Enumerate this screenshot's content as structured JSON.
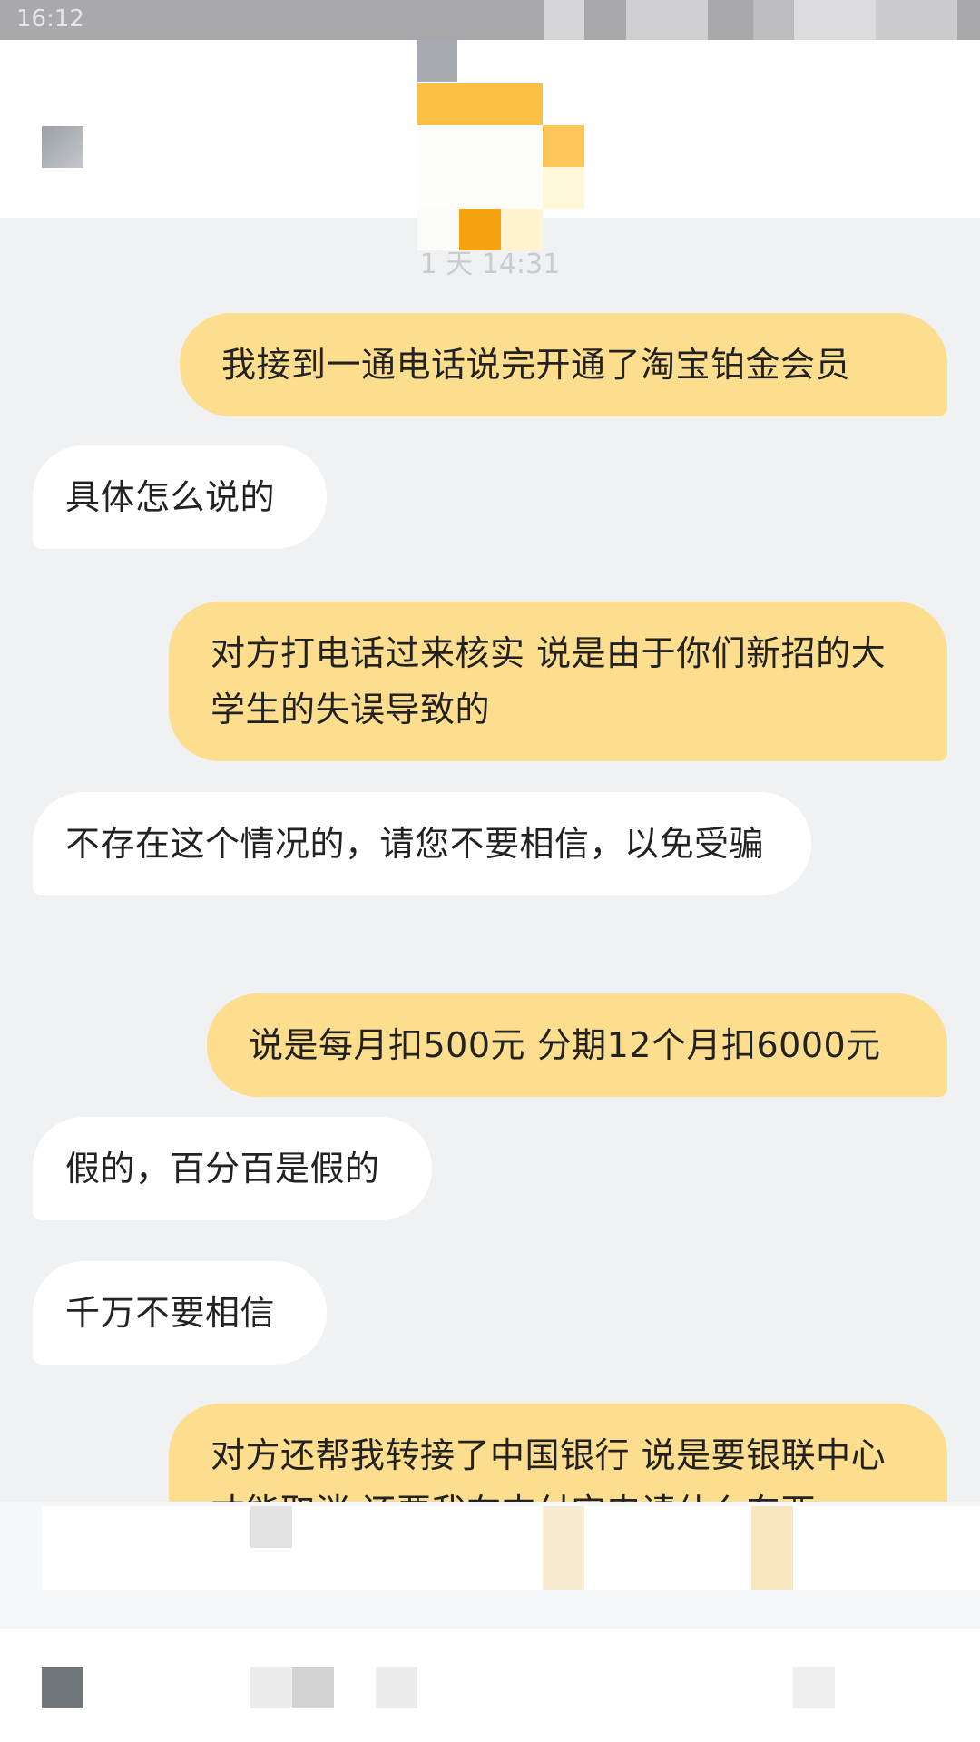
{
  "status_bar": {
    "time": "16:12"
  },
  "header": {
    "contact_name": ""
  },
  "chat": {
    "timestamp": "1 天 14:31",
    "messages": [
      {
        "side": "right",
        "text": "我接到一通电话说完开通了淘宝铂金会员"
      },
      {
        "side": "left",
        "text": "具体怎么说的"
      },
      {
        "side": "right",
        "text": "对方打电话过来核实 说是由于你们新招的大学生的失误导致的"
      },
      {
        "side": "left",
        "text": "不存在这个情况的，请您不要相信，以免受骗"
      },
      {
        "side": "right",
        "text": "说是每月扣500元 分期12个月扣6000元"
      },
      {
        "side": "left",
        "text": "假的，百分百是假的"
      },
      {
        "side": "left",
        "text": "千万不要相信"
      },
      {
        "side": "right",
        "text": "对方还帮我转接了中国银行 说是要银联中心才能取消 还要我在支付宝申请什么东西"
      }
    ]
  },
  "colors": {
    "outgoing_bubble": "#fddd8e",
    "incoming_bubble": "#ffffff",
    "background": "#f0f1f3"
  },
  "icons": [
    "back-icon",
    "voice-icon",
    "emoji-icon",
    "plus-icon"
  ]
}
